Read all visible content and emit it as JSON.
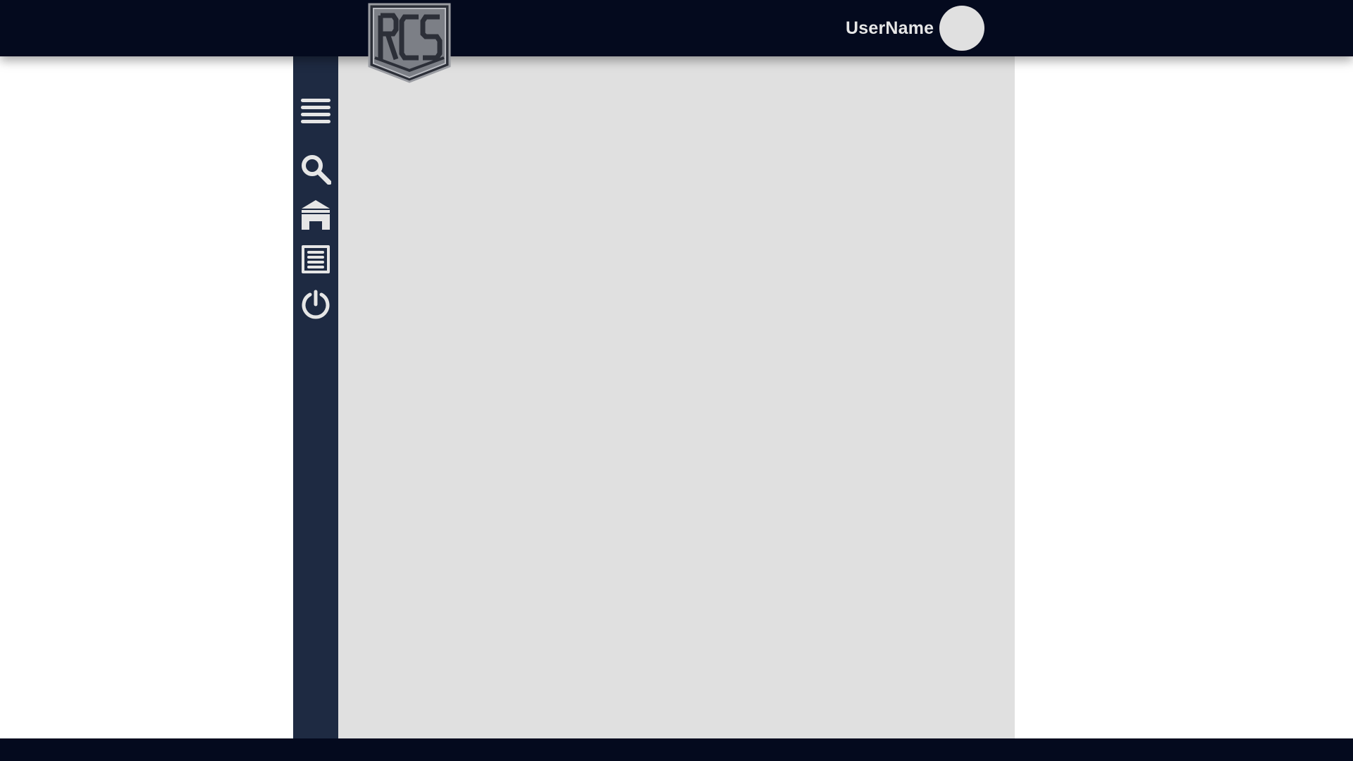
{
  "header": {
    "username": "UserName",
    "logo_text": "RCS"
  },
  "sidebar": {
    "items": [
      {
        "icon": "menu-icon"
      },
      {
        "icon": "search-icon"
      },
      {
        "icon": "home-icon"
      },
      {
        "icon": "document-icon"
      },
      {
        "icon": "power-icon"
      }
    ]
  },
  "colors": {
    "topbar": "#040a1e",
    "sidebar": "#1e2a42",
    "content": "#e0e0e0",
    "icon": "#e6e6e6"
  }
}
